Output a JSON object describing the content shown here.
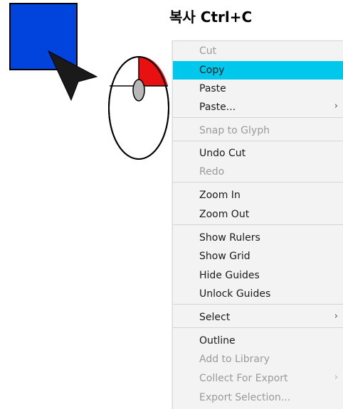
{
  "caption": "복사 Ctrl+C",
  "colors": {
    "highlight": "#00c8ec",
    "square": "#0044dd",
    "mouse_button": "#e81010"
  },
  "icons": [
    "blue-square-icon",
    "cursor-arrow-icon",
    "mouse-left-click-icon"
  ],
  "menu": {
    "items": [
      {
        "label": "Cut",
        "disabled": true
      },
      {
        "label": "Copy",
        "highlighted": true
      },
      {
        "label": "Paste"
      },
      {
        "label": "Paste...",
        "submenu": true,
        "arrow": "›"
      },
      {
        "label": "Snap to Glyph",
        "disabled": true
      },
      {
        "label": "Undo Cut"
      },
      {
        "label": "Redo",
        "disabled": true
      },
      {
        "label": "Zoom In"
      },
      {
        "label": "Zoom Out"
      },
      {
        "label": "Show Rulers"
      },
      {
        "label": "Show Grid"
      },
      {
        "label": "Hide Guides"
      },
      {
        "label": "Unlock Guides"
      },
      {
        "label": "Select",
        "submenu": true,
        "arrow": "›"
      },
      {
        "label": "Outline"
      },
      {
        "label": "Add to Library",
        "disabled": true
      },
      {
        "label": "Collect For Export",
        "disabled": true,
        "submenu": true,
        "arrow": "›"
      },
      {
        "label": "Export Selection...",
        "disabled": true
      }
    ]
  }
}
